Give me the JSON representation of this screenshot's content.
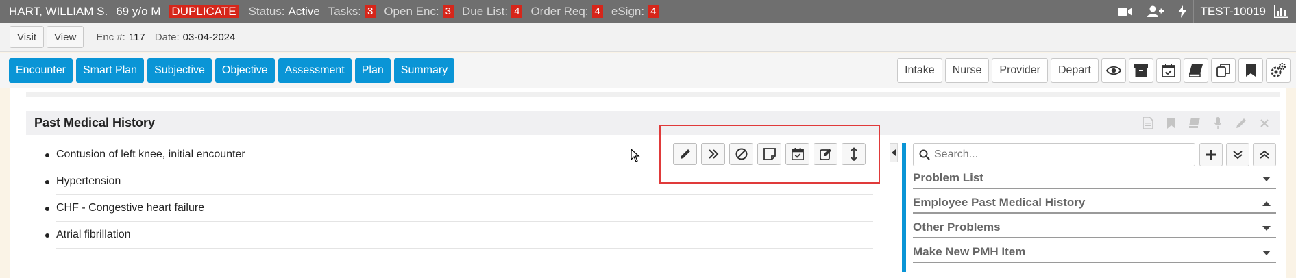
{
  "patient": {
    "name": "HART, WILLIAM S.",
    "age_sex": "69 y/o M",
    "duplicate_label": "DUPLICATE",
    "status_label": "Status:",
    "status_value": "Active",
    "tasks_label": "Tasks:",
    "tasks_count": "3",
    "open_enc_label": "Open Enc:",
    "open_enc_count": "3",
    "due_list_label": "Due List:",
    "due_list_count": "4",
    "order_req_label": "Order Req:",
    "order_req_count": "4",
    "esign_label": "eSign:",
    "esign_count": "4"
  },
  "topbar_right": {
    "env_label": "TEST-10019",
    "icons": [
      "video-icon",
      "add-user-icon",
      "bolt-icon",
      "bar-chart-icon"
    ]
  },
  "subbar": {
    "visit_label": "Visit",
    "view_label": "View",
    "enc_label": "Enc #:",
    "enc_value": "117",
    "date_label": "Date:",
    "date_value": "03-04-2024"
  },
  "nav": {
    "tabs": [
      "Encounter",
      "Smart Plan",
      "Subjective",
      "Objective",
      "Assessment",
      "Plan",
      "Summary"
    ],
    "right_buttons": [
      "Intake",
      "Nurse",
      "Provider",
      "Depart"
    ],
    "right_icons": [
      "eye-icon",
      "archive-icon",
      "calendar-check-icon",
      "book-icon",
      "copy-icon",
      "bookmark-icon",
      "settings-icon"
    ]
  },
  "section": {
    "title": "Past Medical History",
    "items": [
      "Contusion of left knee, initial encounter",
      "Hypertension",
      "CHF - Congestive heart failure",
      "Atrial fibrillation"
    ]
  },
  "sidepanel": {
    "search_placeholder": "Search...",
    "items": [
      {
        "label": "Problem List",
        "arrow": "down"
      },
      {
        "label": "Employee Past Medical History",
        "arrow": "up"
      },
      {
        "label": "Other Problems",
        "arrow": "down"
      },
      {
        "label": "Make New PMH Item",
        "arrow": "down"
      }
    ]
  },
  "colors": {
    "topbar": "#6f6f6f",
    "badge": "#d6261a",
    "accent_blue": "#0a95d6",
    "highlight_red": "#e03a3a"
  }
}
